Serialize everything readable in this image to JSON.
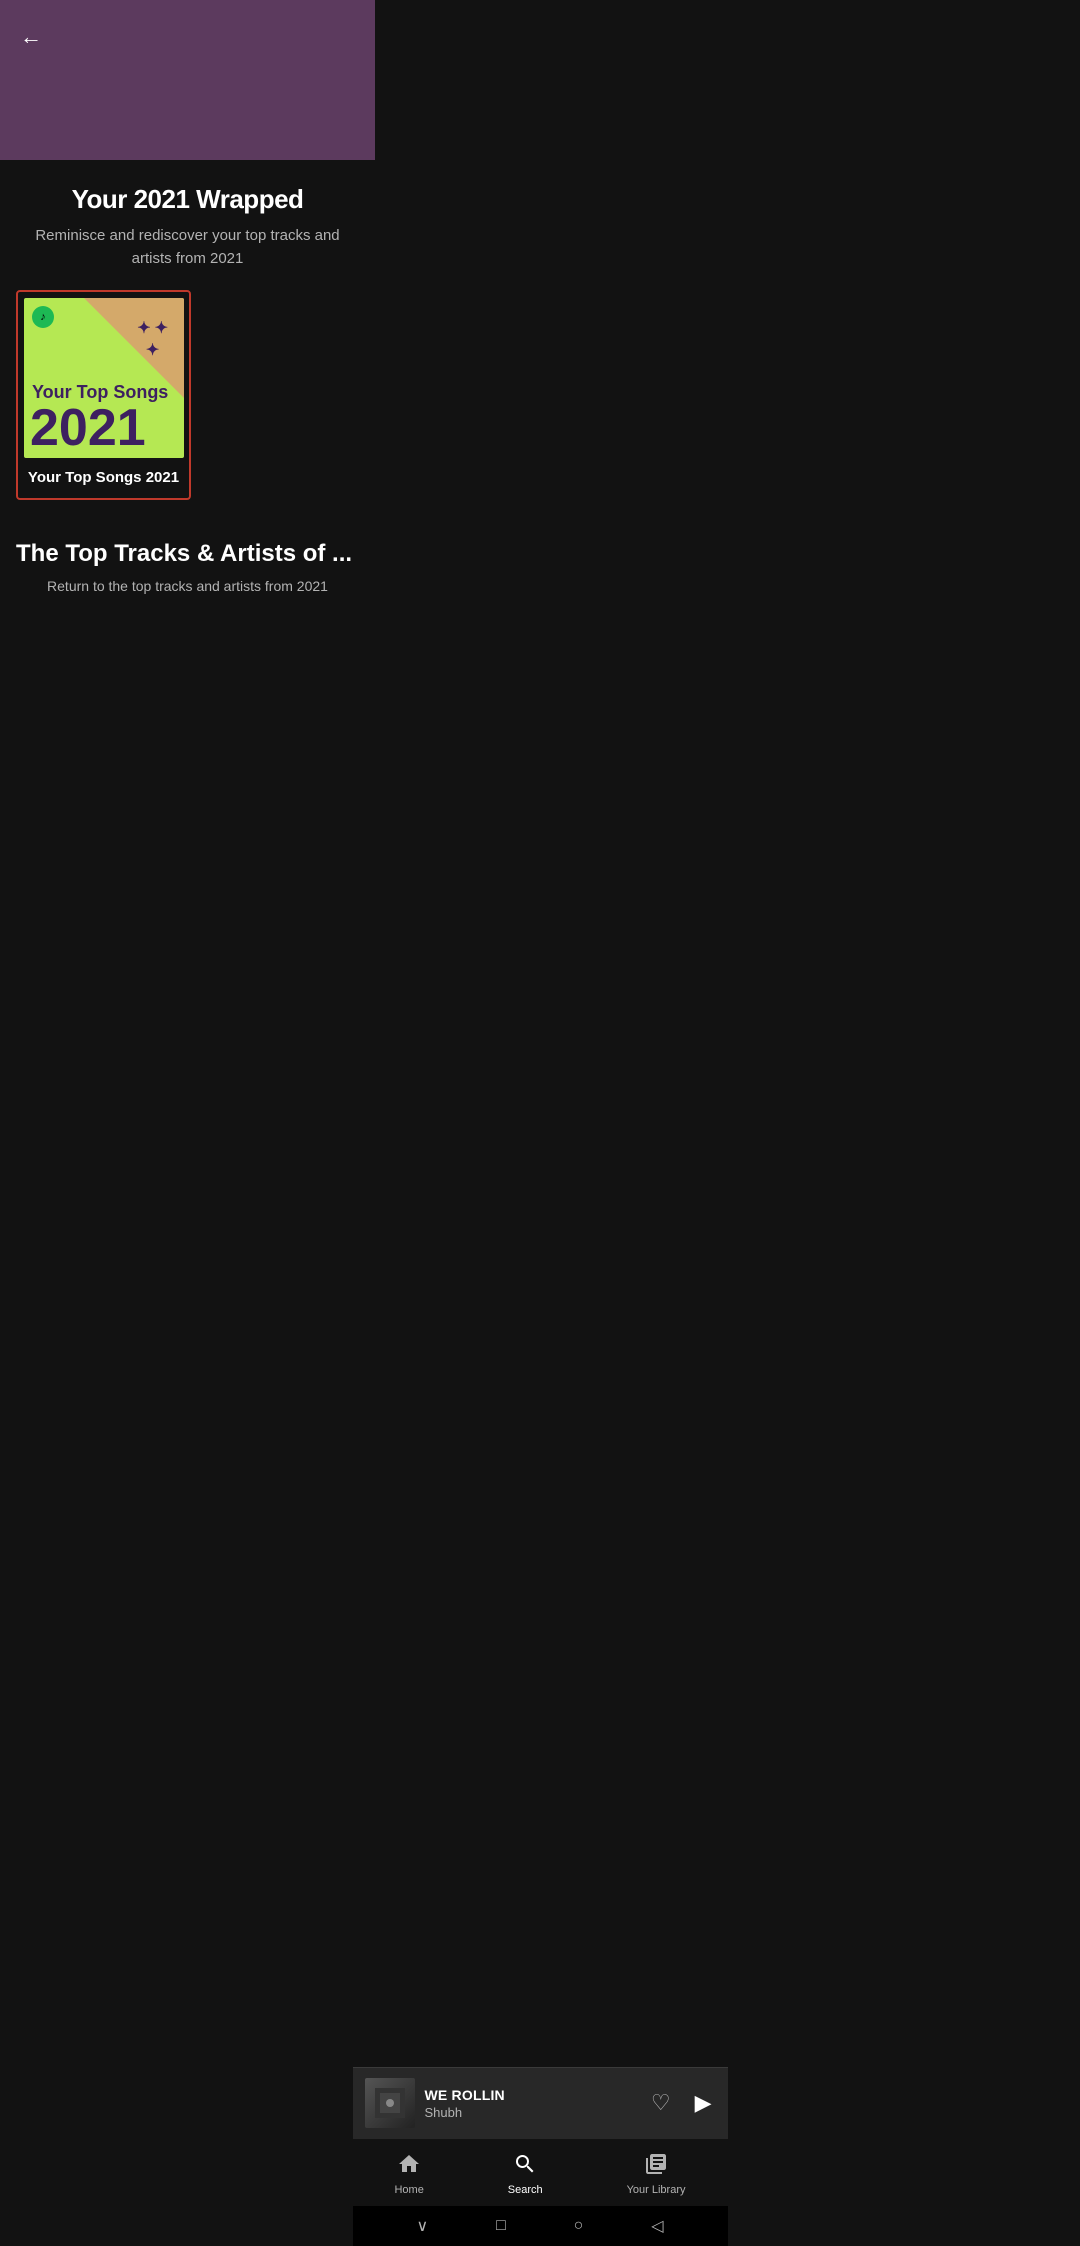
{
  "header": {
    "back_label": "←"
  },
  "section1": {
    "title": "Your 2021 Wrapped",
    "subtitle": "Reminisce and rediscover your top tracks and artists from 2021"
  },
  "playlist": {
    "name": "Your Top Songs 2021",
    "cover_top_text": "Your Top Songs",
    "cover_year": "2021"
  },
  "section2": {
    "title": "The Top Tracks & Artists of ...",
    "subtitle": "Return to the top tracks and artists from 2021"
  },
  "mini_player": {
    "track_title": "WE ROLLIN",
    "artist": "Shubh"
  },
  "bottom_nav": {
    "home_label": "Home",
    "search_label": "Search",
    "library_label": "Your Library"
  },
  "system_nav": {
    "chevron_down": "∨",
    "square": "□",
    "circle": "○",
    "back_triangle": "◁"
  }
}
